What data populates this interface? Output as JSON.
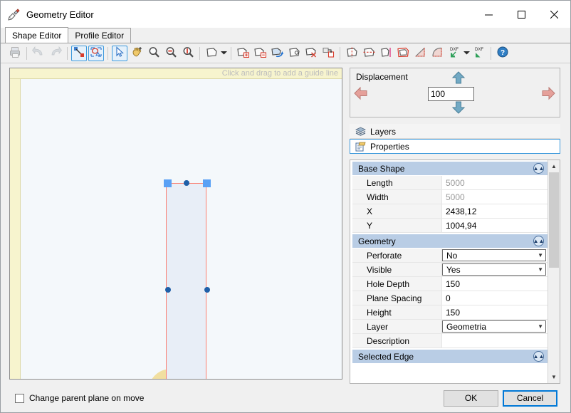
{
  "window": {
    "title": "Geometry Editor",
    "icon": "geometry-editor-icon",
    "minimize_label": "—",
    "maximize_label": "□",
    "close_label": "✕"
  },
  "tabs": [
    {
      "label": "Shape Editor",
      "active": true
    },
    {
      "label": "Profile Editor",
      "active": false
    }
  ],
  "toolbar": {
    "buttons": [
      {
        "name": "print-icon",
        "glyph": "printer",
        "state": "disabled"
      },
      {
        "sep": true
      },
      {
        "name": "undo-icon",
        "glyph": "undo",
        "state": "disabled"
      },
      {
        "name": "redo-icon",
        "glyph": "redo",
        "state": "disabled"
      },
      {
        "sep": true
      },
      {
        "name": "snap-to-point-icon",
        "glyph": "snap-point",
        "state": "selected"
      },
      {
        "name": "snap-to-shape-icon",
        "glyph": "snap-shape",
        "state": "selected"
      },
      {
        "sep": true
      },
      {
        "name": "select-arrow-icon",
        "glyph": "arrow",
        "state": "selected"
      },
      {
        "name": "pan-hand-icon",
        "glyph": "hand"
      },
      {
        "name": "zoom-in-icon",
        "glyph": "zoom"
      },
      {
        "name": "zoom-out-icon",
        "glyph": "zoom-out"
      },
      {
        "name": "zoom-fit-icon",
        "glyph": "zoom-one"
      },
      {
        "sep": true
      },
      {
        "name": "new-shape-icon",
        "glyph": "shape"
      },
      {
        "name": "new-shape-dropdown-icon",
        "glyph": "caret"
      },
      {
        "sep": true
      },
      {
        "name": "add-shape-icon",
        "glyph": "shape-plus"
      },
      {
        "name": "remove-shape-icon",
        "glyph": "shape-minus"
      },
      {
        "name": "merge-shapes-icon",
        "glyph": "shape-merge"
      },
      {
        "name": "copy-shape-icon",
        "glyph": "shape-copy"
      },
      {
        "name": "delete-shape-icon",
        "glyph": "shape-delete"
      },
      {
        "name": "duplicate-shape-icon",
        "glyph": "shape-dup"
      },
      {
        "sep": true
      },
      {
        "name": "mirror-vertical-icon",
        "glyph": "mirror-v"
      },
      {
        "name": "mirror-horizontal-icon",
        "glyph": "mirror-h"
      },
      {
        "name": "split-shape-icon",
        "glyph": "split"
      },
      {
        "name": "offset-shape-icon",
        "glyph": "offset"
      },
      {
        "name": "fillet-edge-icon",
        "glyph": "fillet"
      },
      {
        "name": "chamfer-edge-icon",
        "glyph": "chamfer"
      },
      {
        "name": "dxf-import-icon",
        "glyph": "dxf-in"
      },
      {
        "name": "dxf-import-dropdown-icon",
        "glyph": "caret"
      },
      {
        "name": "dxf-export-icon",
        "glyph": "dxf-out"
      },
      {
        "sep": true
      },
      {
        "name": "help-icon",
        "glyph": "help"
      }
    ]
  },
  "canvas": {
    "hint": "Click and drag to add a guide line",
    "ruler_color": "#f7f4ce",
    "background_color": "#f4f8fb",
    "shape_fill": "#e8eef7",
    "shape_outline": "#fa8072",
    "handle_color": "#5aa1f5",
    "node_color": "#1f5fa8",
    "sector_color": "#f1dfa0",
    "direction_arrow_color": "#0000e0"
  },
  "displacement": {
    "label": "Displacement",
    "value": "100",
    "up_button": "displacement-up-arrow",
    "down_button": "displacement-down-arrow",
    "left_button": "displacement-left-arrow",
    "right_button": "displacement-right-arrow"
  },
  "panel_tabs": [
    {
      "label": "Layers",
      "icon": "layers-icon",
      "active": false
    },
    {
      "label": "Properties",
      "icon": "properties-icon",
      "active": true
    }
  ],
  "property_grid": {
    "categories": [
      {
        "name": "Base Shape",
        "rows": [
          {
            "name": "Length",
            "value": "5000",
            "type": "readonly"
          },
          {
            "name": "Width",
            "value": "5000",
            "type": "readonly"
          },
          {
            "name": "X",
            "value": "2438,12",
            "type": "text"
          },
          {
            "name": "Y",
            "value": "1004,94",
            "type": "text"
          }
        ]
      },
      {
        "name": "Geometry",
        "rows": [
          {
            "name": "Perforate",
            "value": "No",
            "type": "combo"
          },
          {
            "name": "Visible",
            "value": "Yes",
            "type": "combo"
          },
          {
            "name": "Hole Depth",
            "value": "150",
            "type": "text"
          },
          {
            "name": "Plane Spacing",
            "value": "0",
            "type": "text"
          },
          {
            "name": "Height",
            "value": "150",
            "type": "text"
          },
          {
            "name": "Layer",
            "value": "Geometria",
            "type": "combo"
          },
          {
            "name": "Description",
            "value": "",
            "type": "text"
          }
        ]
      },
      {
        "name": "Selected Edge",
        "rows": []
      }
    ]
  },
  "footer": {
    "checkbox_label": "Change parent plane on move",
    "checkbox_checked": false,
    "ok_label": "OK",
    "cancel_label": "Cancel"
  }
}
